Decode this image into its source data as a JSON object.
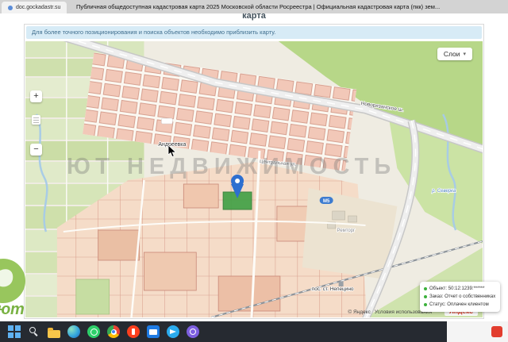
{
  "browser": {
    "tab": "doc.gockadastr.su",
    "title": "Публичная общедоступная кадастровая карта 2025 Московской области Росреестра | Официальная кадастровая карта (пкк) зем..."
  },
  "page": {
    "heading_fragment": "карта",
    "notice": "Для более точного позиционирования и поиска объектов необходимо приблизить карту."
  },
  "map": {
    "layers_button": "Слои",
    "zoom_in": "+",
    "zoom_out": "−",
    "watermark_text": "ЮТ НЕДВИЖИМОСТЬ",
    "watermark_logo_text": "ют",
    "labels": {
      "highway": "Новорязанское ш.",
      "village": "Андреевка",
      "street": "Центральная ул.",
      "poi": "Ремторг",
      "station": "пос. ст. Непецино",
      "river": "р. Северка",
      "route_badge": "М5"
    },
    "attribution": {
      "copyright": "© Яндекс",
      "terms": "Условия использования",
      "logo": "Яндекс"
    }
  },
  "info_card": {
    "object": "Объект: 50:12:1239:******",
    "order": "Заказ: Отчет о собственниках",
    "status": "Статус: Оплачен клиентом"
  },
  "colors": {
    "status_green": "#3cb13c",
    "pin_blue": "#2e6fd0",
    "notice_bg": "#d7ebf6",
    "selected_parcel": "#3fa044"
  },
  "taskbar": {
    "icons": [
      "start-icon",
      "search-icon",
      "file-explorer-icon",
      "edge-icon",
      "whatsapp-icon",
      "chrome-icon",
      "yandex-browser-icon",
      "mail-icon",
      "telegram-icon",
      "viber-icon"
    ]
  }
}
